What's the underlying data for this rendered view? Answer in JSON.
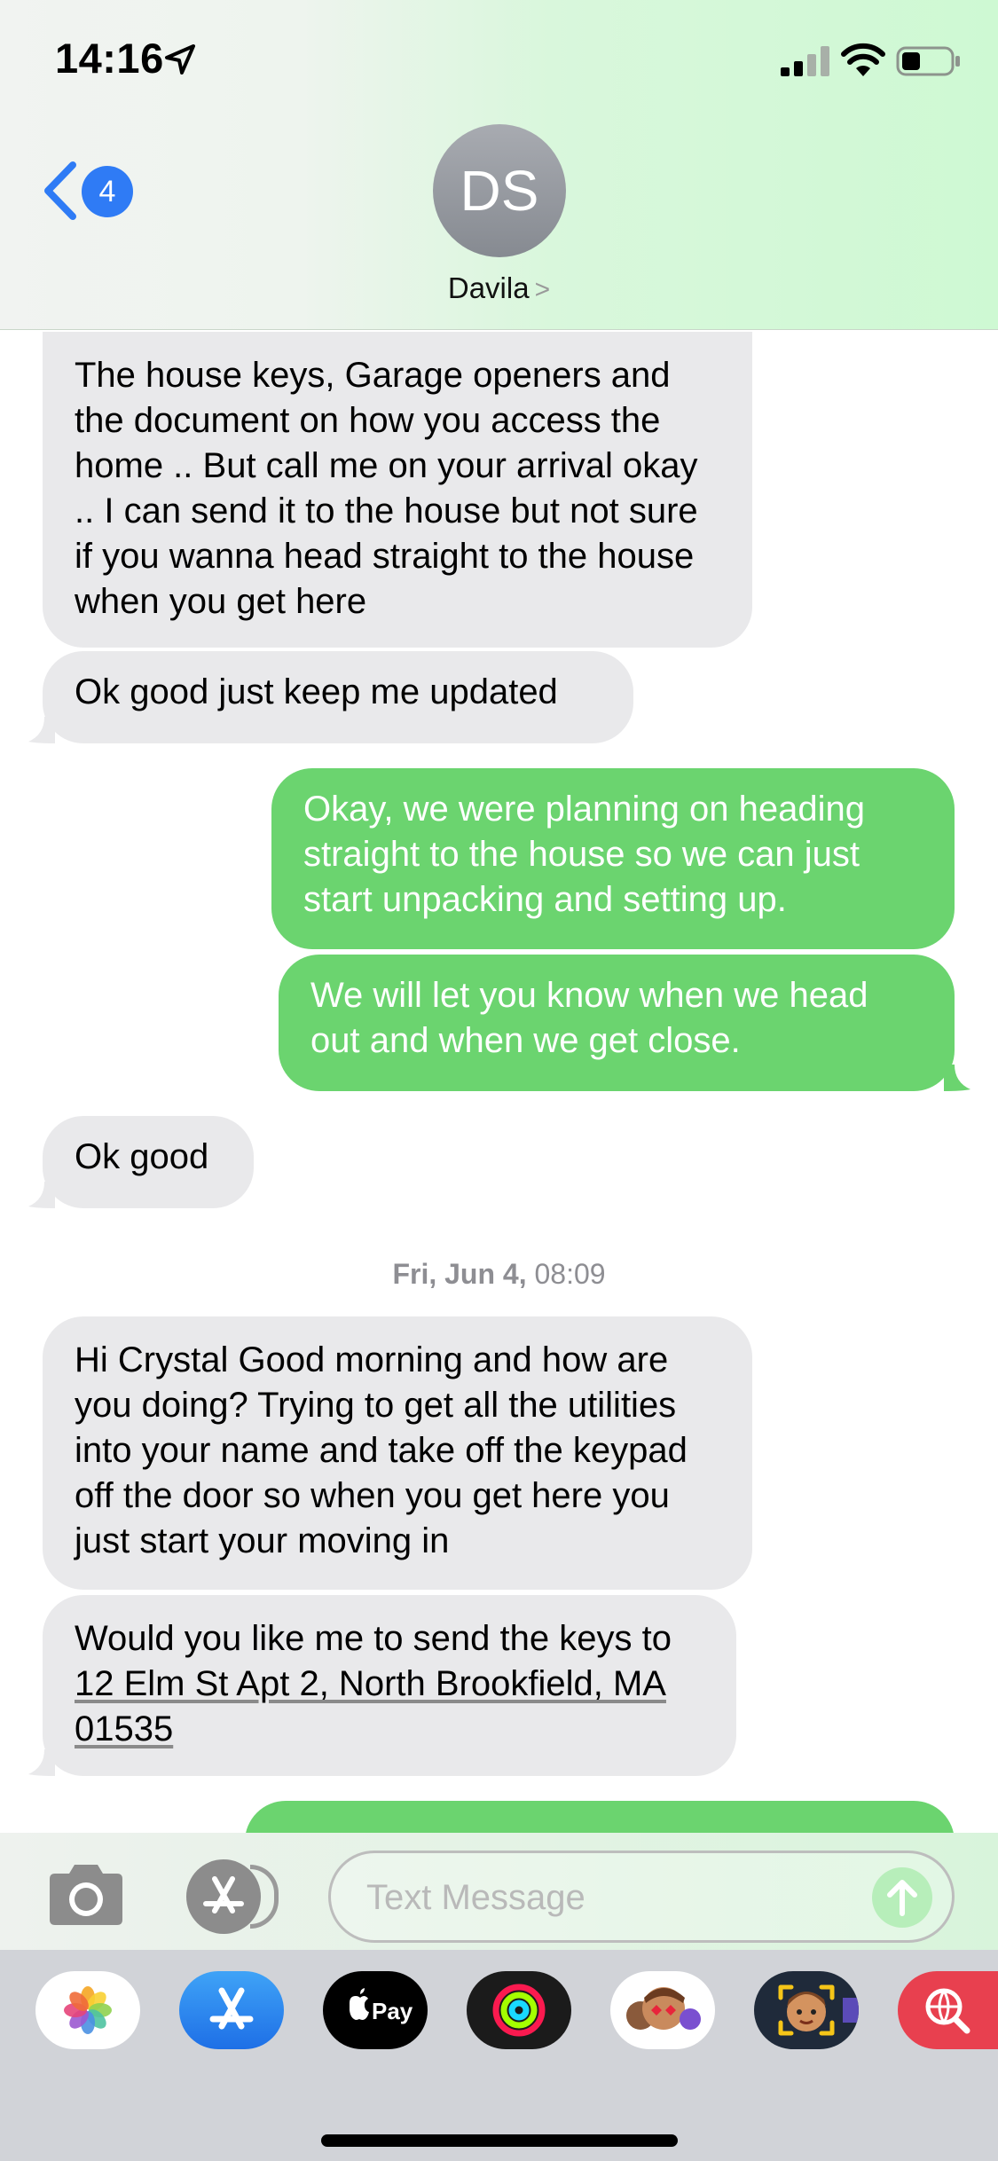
{
  "status_bar": {
    "time": "14:16",
    "icons": [
      "location-arrow-icon",
      "cellular-signal-icon",
      "wifi-icon",
      "battery-icon"
    ]
  },
  "header": {
    "back_badge": "4",
    "avatar_initials": "DS",
    "contact_name": "Davila",
    "name_chevron": ">"
  },
  "messages": [
    {
      "side": "received",
      "text": "The house keys, Garage openers and the document on how you access the home .. But call me on your arrival okay .. I can send it to the house but not sure if you wanna head straight to the house when you get here"
    },
    {
      "side": "received",
      "text": "Ok good just keep me updated"
    },
    {
      "side": "sent",
      "text": "Okay, we were planning on heading straight to the house so we can just start unpacking and setting up."
    },
    {
      "side": "sent",
      "text": "We will let you know when we head out and when we get close."
    },
    {
      "side": "received",
      "text": "Ok good"
    },
    {
      "side": "received",
      "text": "Hi Crystal Good morning and how are you doing? Trying to get all the utilities into your name and take off the keypad off the door so when you get here you just start your moving in"
    },
    {
      "side": "received",
      "text_before": "Would you like me to send the keys to ",
      "address": "12 Elm St Apt 2, North Brookfield, MA 01535"
    }
  ],
  "timestamp": {
    "day": "Fri, Jun 4,",
    "time": "08:09"
  },
  "input": {
    "placeholder": "Text Message"
  },
  "app_drawer": [
    "photos-app-icon",
    "app-store-icon",
    "apple-pay-icon",
    "activity-icon",
    "memoji-stickers-icon",
    "memoji-icon",
    "search-images-icon"
  ],
  "colors": {
    "sent_bubble": "#6bd46f",
    "received_bubble": "#e9e9eb",
    "accent": "#2f7bf5"
  }
}
